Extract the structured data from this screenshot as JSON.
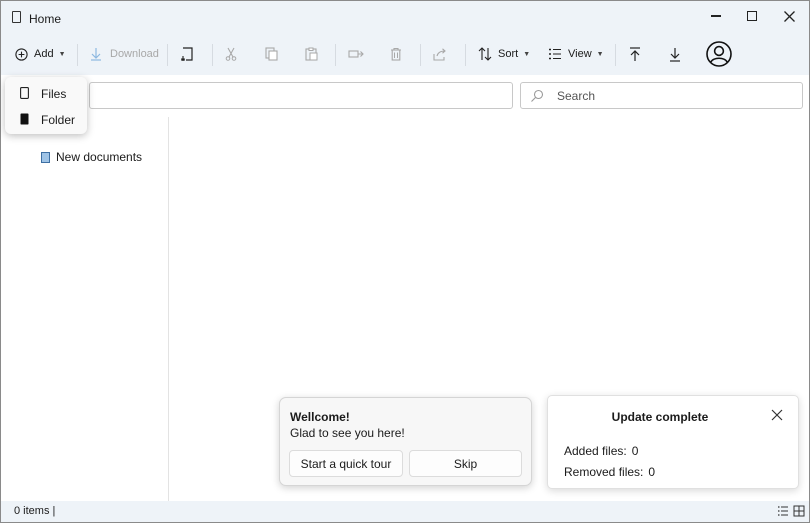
{
  "window": {
    "title": "Home",
    "icon": "document-icon"
  },
  "toolbar": {
    "add_label": "Add",
    "download_label": "Download",
    "sort_label": "Sort",
    "view_label": "View"
  },
  "add_menu": {
    "items": [
      {
        "label": "Files",
        "icon": "file-outline-icon"
      },
      {
        "label": "Folder",
        "icon": "folder-filled-icon"
      }
    ]
  },
  "search": {
    "placeholder": "Search"
  },
  "nav": {
    "items": [
      {
        "label": "New documents",
        "icon": "document-icon"
      }
    ]
  },
  "status": {
    "text": "0 items |"
  },
  "welcome_popup": {
    "title": "Wellcome!",
    "body": "Glad to see you here!",
    "tour_button": "Start a quick tour",
    "skip_button": "Skip"
  },
  "update_notification": {
    "title": "Update complete",
    "added_label": "Added files:",
    "added_value": "0",
    "removed_label": "Removed files:",
    "removed_value": "0"
  },
  "colors": {
    "chrome_bg": "#eef3f8",
    "disabled_text": "#a8a8a8",
    "doc_icon_fill": "#9ec3e6"
  }
}
